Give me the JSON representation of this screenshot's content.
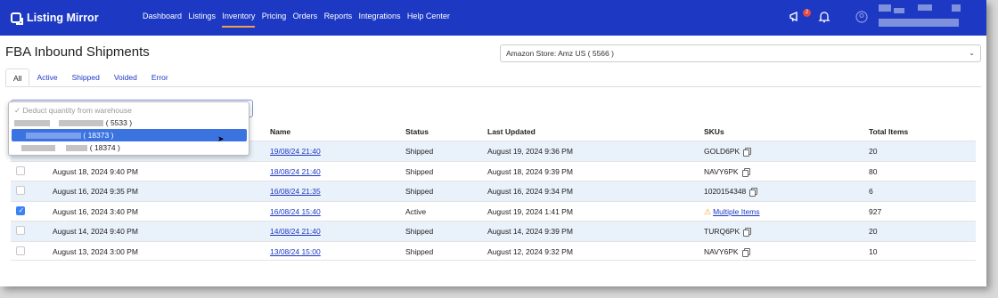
{
  "app": {
    "logo_text": "Listing Mirror",
    "brand_color": "#1d39c4",
    "accent_color": "#f0a04b",
    "notification_count": "2"
  },
  "nav": [
    {
      "label": "Dashboard"
    },
    {
      "label": "Listings"
    },
    {
      "label": "Inventory",
      "active": true
    },
    {
      "label": "Pricing"
    },
    {
      "label": "Orders"
    },
    {
      "label": "Reports"
    },
    {
      "label": "Integrations"
    },
    {
      "label": "Help Center"
    }
  ],
  "page": {
    "title": "FBA Inbound Shipments",
    "store_select_value": "Amazon Store: Amz US ( 5566 )"
  },
  "tabs": [
    {
      "label": "All",
      "active": true
    },
    {
      "label": "Active"
    },
    {
      "label": "Shipped"
    },
    {
      "label": "Voided"
    },
    {
      "label": "Error"
    }
  ],
  "dropdown": {
    "placeholder": "✓ Deduct quantity from warehouse",
    "options": [
      {
        "label": "( 5533 )"
      },
      {
        "label": "( 18373 )",
        "selected": true
      },
      {
        "label": "( 18374 )"
      }
    ]
  },
  "table": {
    "columns": [
      "Name",
      "Status",
      "Last Updated",
      "SKUs",
      "Total Items"
    ],
    "rows": [
      {
        "created": "",
        "name": "19/08/24 21:40",
        "status": "Shipped",
        "updated": "August 19, 2024 9:36 PM",
        "sku": "GOLD6PK",
        "total": "20",
        "checked": false
      },
      {
        "created": "August 18, 2024 9:40 PM",
        "name": "18/08/24 21:40",
        "status": "Shipped",
        "updated": "August 18, 2024 9:39 PM",
        "sku": "NAVY6PK",
        "total": "80",
        "checked": false
      },
      {
        "created": "August 16, 2024 9:35 PM",
        "name": "16/08/24 21:35",
        "status": "Shipped",
        "updated": "August 16, 2024 9:34 PM",
        "sku": "1020154348",
        "total": "6",
        "checked": false
      },
      {
        "created": "August 16, 2024 3:40 PM",
        "name": "16/08/24 15:40",
        "status": "Active",
        "updated": "August 19, 2024 1:41 PM",
        "sku": "Multiple Items",
        "total": "927",
        "checked": true
      },
      {
        "created": "August 14, 2024 9:40 PM",
        "name": "14/08/24 21:40",
        "status": "Shipped",
        "updated": "August 14, 2024 9:39 PM",
        "sku": "TURQ6PK",
        "total": "20",
        "checked": false
      },
      {
        "created": "August 13, 2024 3:00 PM",
        "name": "13/08/24 15:00",
        "status": "Shipped",
        "updated": "August 12, 2024 9:32 PM",
        "sku": "NAVY6PK",
        "total": "10",
        "checked": false
      }
    ]
  }
}
